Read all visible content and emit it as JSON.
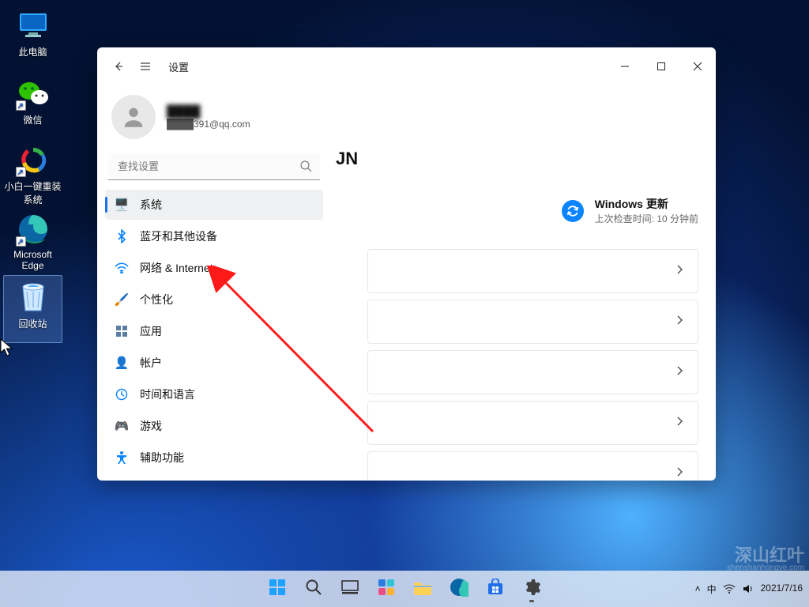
{
  "desktop": {
    "icons": [
      {
        "name": "this-pc",
        "label": "此电脑",
        "glyph": "pc"
      },
      {
        "name": "wechat",
        "label": "微信",
        "glyph": "wechat",
        "link": true
      },
      {
        "name": "xiaobai-reinstall",
        "label": "小白一键重装系统",
        "glyph": "recycle-arrows",
        "link": true
      },
      {
        "name": "edge",
        "label": "Microsoft Edge",
        "glyph": "edge",
        "link": true
      },
      {
        "name": "recycle-bin",
        "label": "回收站",
        "glyph": "bin",
        "selected": true
      }
    ]
  },
  "settings": {
    "title": "设置",
    "profile": {
      "name": "████",
      "email_masked": "████391@qq.com"
    },
    "search_placeholder": "查找设置",
    "nav": [
      {
        "name": "system",
        "label": "系统",
        "glyph": "🖥️",
        "selected": true
      },
      {
        "name": "bluetooth",
        "label": "蓝牙和其他设备",
        "glyph": "bt"
      },
      {
        "name": "network",
        "label": "网络 & Internet",
        "glyph": "wifi"
      },
      {
        "name": "personalize",
        "label": "个性化",
        "glyph": "🖌️"
      },
      {
        "name": "apps",
        "label": "应用",
        "glyph": "apps"
      },
      {
        "name": "accounts",
        "label": "帐户",
        "glyph": "👤"
      },
      {
        "name": "time-lang",
        "label": "时间和语言",
        "glyph": "clock"
      },
      {
        "name": "gaming",
        "label": "游戏",
        "glyph": "🎮"
      },
      {
        "name": "a11y",
        "label": "辅助功能",
        "glyph": "a11y"
      }
    ],
    "hero": {
      "suffix": "JN"
    },
    "update": {
      "title": "Windows 更新",
      "subtitle": "上次检查时间: 10 分钟前"
    },
    "cards": [
      {},
      {},
      {},
      {},
      {}
    ]
  },
  "arrow": {
    "comment": "red annotation arrow pointing to 网络 & Internet"
  },
  "taskbar": {
    "items": [
      {
        "name": "start",
        "glyph": "start"
      },
      {
        "name": "search",
        "glyph": "search"
      },
      {
        "name": "taskview",
        "glyph": "taskview"
      },
      {
        "name": "widgets",
        "glyph": "widgets"
      },
      {
        "name": "explorer",
        "glyph": "explorer"
      },
      {
        "name": "edge",
        "glyph": "edge"
      },
      {
        "name": "store",
        "glyph": "store"
      },
      {
        "name": "settings",
        "glyph": "gear",
        "active": true
      }
    ],
    "tray": {
      "ime": "中",
      "time": "",
      "date": "2021/7/16"
    },
    "chevron": "˄"
  },
  "watermark": {
    "big": "深山红叶",
    "small": "shenshanhongye.com"
  }
}
